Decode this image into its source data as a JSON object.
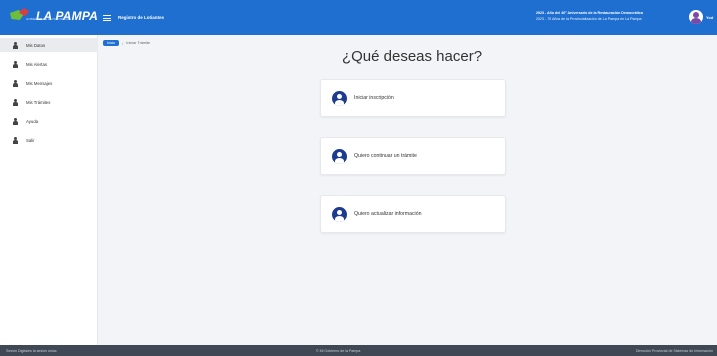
{
  "header": {
    "logo_text": "LA PAMPA",
    "logo_subtitle": "GOBIERNO DE LA PROVINCIA",
    "title": "Registro de Lotiantes",
    "notice_line1": "2023 - Año del 40° Aniversario de la Restauración Democrática",
    "notice_line2": "2023 - 70 Años de la Provincialización de La Pampa en La Pampa",
    "user_name": "Yod"
  },
  "sidebar": {
    "items": [
      {
        "label": "Mis Datos",
        "icon": "user-icon"
      },
      {
        "label": "Mis Alertas",
        "icon": "user-icon"
      },
      {
        "label": "Mis Mensajes",
        "icon": "user-icon"
      },
      {
        "label": "Mis Trámites",
        "icon": "user-icon"
      },
      {
        "label": "Ayuda",
        "icon": "user-icon"
      },
      {
        "label": "Salir",
        "icon": "user-icon"
      }
    ]
  },
  "breadcrumb": {
    "home": "Inicio",
    "separator": "/",
    "current": "Iniciar Trámite"
  },
  "main": {
    "heading": "¿Qué deseas hacer?",
    "options": [
      {
        "label": "Iniciar inscripción",
        "icon": "user-circle-icon"
      },
      {
        "label": "Quiero continuar un trámite",
        "icon": "user-circle-icon"
      },
      {
        "label": "Quiero actualizar información",
        "icon": "user-circle-icon"
      }
    ]
  },
  "footer": {
    "left": "Sesión Digitales la sesión única",
    "center": "© Mi Gobierno de la Pampa",
    "right": "Dirección Provincial de Sistemas de Información"
  },
  "colors": {
    "header": "#1f6fd1",
    "footer": "#3f4854",
    "icon": "#1d3b8f"
  }
}
